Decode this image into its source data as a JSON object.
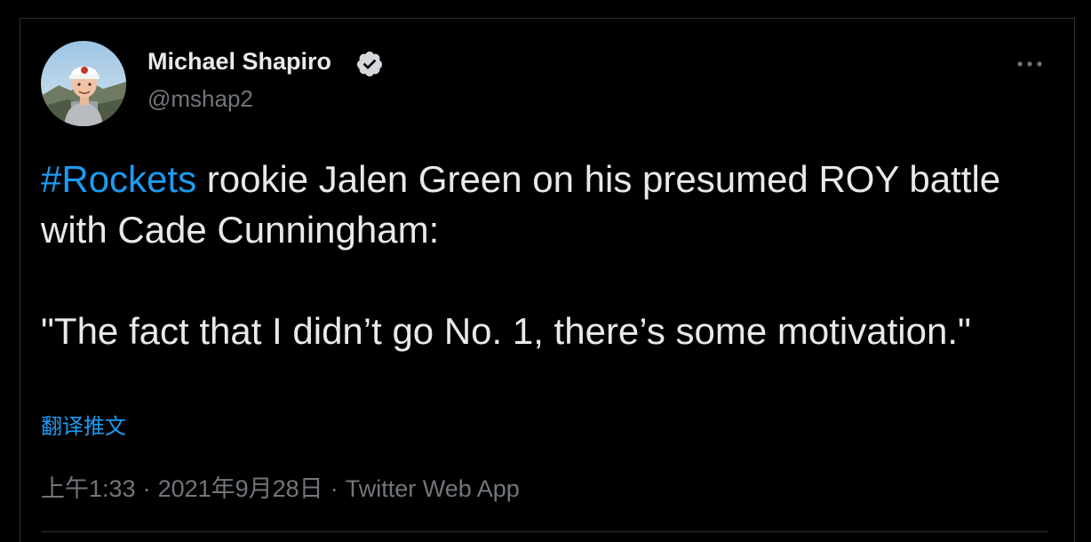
{
  "author": {
    "display_name": "Michael Shapiro",
    "handle": "@mshap2",
    "verified_icon": "verified-badge-icon",
    "avatar_icon": "avatar"
  },
  "more_icon": "more-icon",
  "tweet": {
    "hashtag": "#Rockets",
    "line1_rest": " rookie Jalen Green on his presumed ROY battle with Cade Cunningham:",
    "quote": "\"The fact that I didn’t go No. 1, there’s some motivation.\""
  },
  "translate_label": "翻译推文",
  "meta": {
    "time": "上午1:33",
    "date": "2021年9月28日",
    "source": "Twitter Web App",
    "separator": "·"
  },
  "colors": {
    "background": "#000000",
    "text": "#e7e9ea",
    "muted": "#71767b",
    "accent": "#1d9bf0",
    "divider": "#2f3336"
  }
}
